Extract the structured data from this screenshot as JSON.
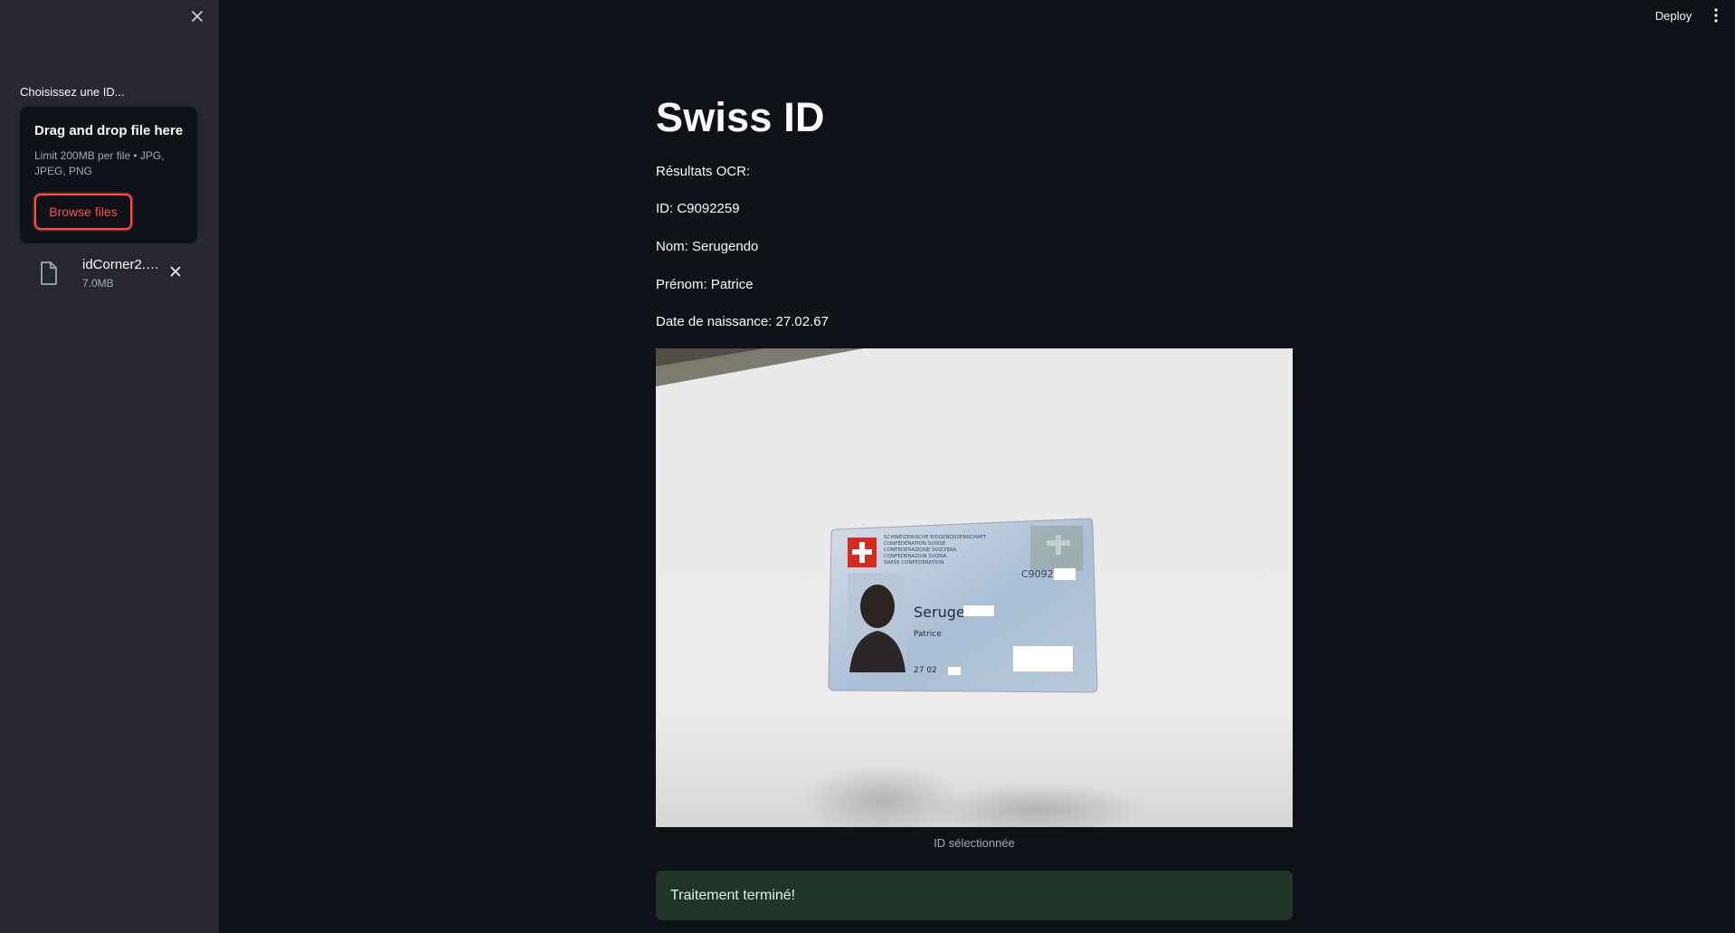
{
  "sidebar": {
    "uploader_label": "Choisissez une ID...",
    "dropzone": {
      "title": "Drag and drop file here",
      "limit_text": "Limit 200MB per file • JPG, JPEG, PNG",
      "browse_label": "Browse files"
    },
    "file": {
      "name": "idCorner2.…",
      "size": "7.0MB"
    }
  },
  "header": {
    "deploy_label": "Deploy"
  },
  "main": {
    "title": "Swiss ID",
    "ocr_heading": "Résultats OCR:",
    "id_line": "ID: C9092259",
    "nom_line": "Nom: Serugendo",
    "prenom_line": "Prénom: Patrice",
    "dob_line": "Date de naissance: 27.02.67",
    "image_caption": "ID sélectionnée",
    "success_message": "Traitement terminé!"
  },
  "id_card": {
    "header_lines": [
      "SCHWEIZERISCHE EIDGENOSSENSCHAFT",
      "CONFÉDÉRATION SUISSE",
      "CONFEDERAZIONE SVIZZERA",
      "CONFEDERAZIUN SVIZRA",
      "SWISS CONFEDERATION"
    ],
    "id_partial": "C9092",
    "surname_partial": "Seruge",
    "given_name": "Patrice",
    "dob_partial": "27 02"
  },
  "colors": {
    "sidebar_bg": "#262730",
    "app_bg": "#0e1117",
    "accent": "#ff4b4b",
    "success_bg": "#1f3527"
  },
  "icons": {
    "sidebar_close": "close-icon",
    "file": "file-icon",
    "file_remove": "close-icon",
    "menu": "vertical-dots-icon"
  }
}
